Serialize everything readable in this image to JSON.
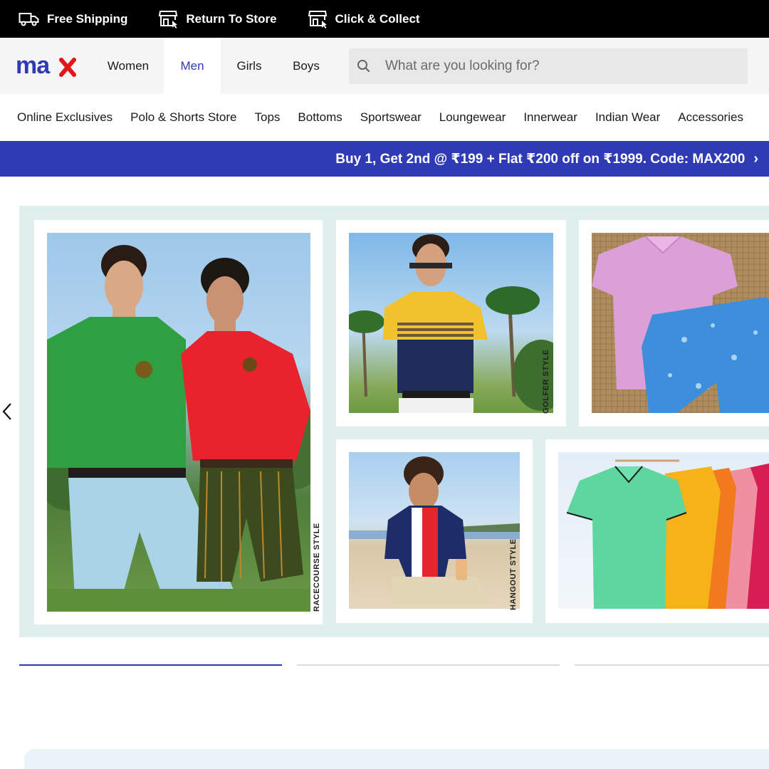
{
  "topbar": {
    "items": [
      {
        "label": "Free Shipping",
        "icon": "truck-icon"
      },
      {
        "label": "Return To Store",
        "icon": "store-icon"
      },
      {
        "label": "Click & Collect",
        "icon": "store-icon"
      }
    ]
  },
  "header": {
    "logo_text": "max",
    "logo_color": "#2f3bb5",
    "logo_accent": "#e2151d",
    "tabs": [
      {
        "label": "Women",
        "active": false
      },
      {
        "label": "Men",
        "active": true
      },
      {
        "label": "Girls",
        "active": false
      },
      {
        "label": "Boys",
        "active": false
      }
    ],
    "search": {
      "placeholder": "What are you looking for?",
      "value": "",
      "icon": "search-icon"
    }
  },
  "categories": [
    "Online Exclusives",
    "Polo & Shorts Store",
    "Tops",
    "Bottoms",
    "Sportswear",
    "Loungewear",
    "Innerwear",
    "Indian Wear",
    "Accessories"
  ],
  "promo": {
    "text": "Buy 1, Get 2nd @ ₹199 + Flat ₹200 off on ₹1999. Code: MAX200",
    "chevron": "›",
    "background": "#2f3bb5"
  },
  "banner": {
    "background": "#dfefee",
    "captions": {
      "racecourse": "RACECOURSE STYLE",
      "golfer": "GOLFER STYLE",
      "hangout": "HANGOUT STYLE"
    }
  },
  "carousel": {
    "slide_count": 3,
    "active_index": 0,
    "accent": "#2f3bb5"
  }
}
